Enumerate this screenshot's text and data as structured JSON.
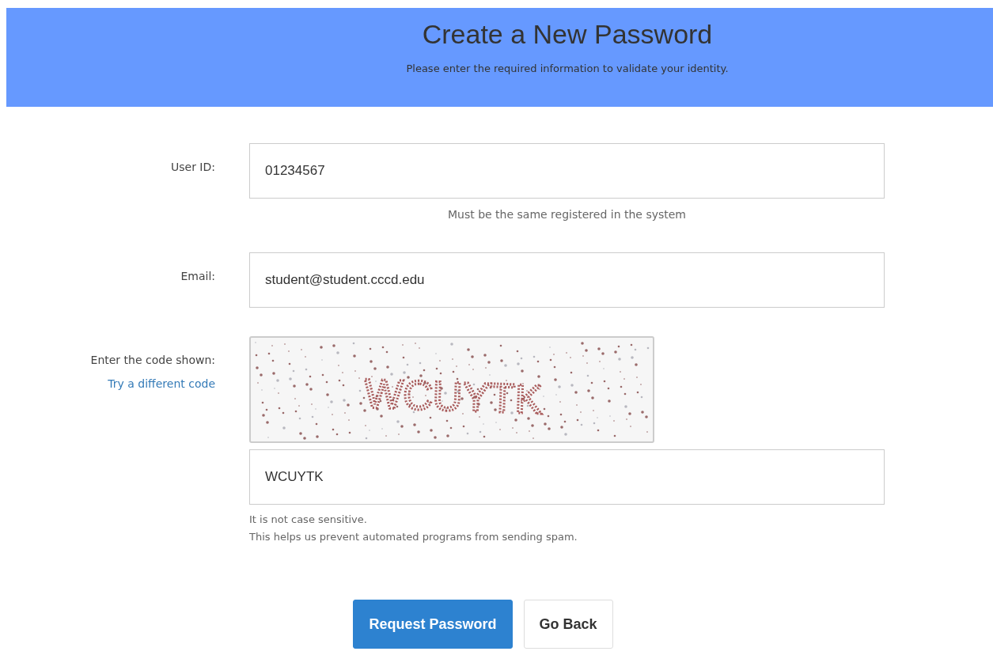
{
  "header": {
    "title": "Create a New Password",
    "subtitle": "Please enter the required information to validate your identity."
  },
  "fields": [
    {
      "label": "User ID:",
      "value": "01234567",
      "hint": "Must be the same registered in the system"
    },
    {
      "label": "Email:",
      "value": "student@student.cccd.edu"
    }
  ],
  "captcha": {
    "label": "Enter the code shown:",
    "link": "Try a different code",
    "image_text": "WCUYTK",
    "value": "WCUYTK",
    "notes": [
      "It is not case sensitive.",
      "This helps us prevent automated programs from sending spam."
    ]
  },
  "buttons": [
    {
      "label": "Request Password",
      "kind": "primary"
    },
    {
      "label": "Go Back",
      "kind": "secondary"
    }
  ]
}
